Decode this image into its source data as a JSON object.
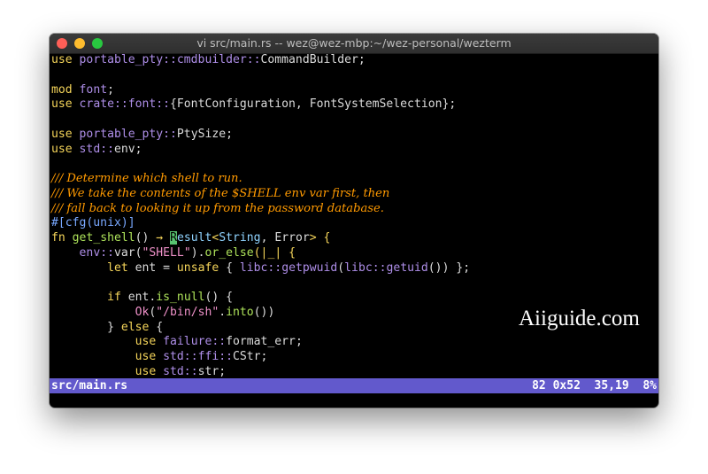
{
  "window": {
    "title": "vi src/main.rs -- wez@wez-mbp:~/wez-personal/wezterm"
  },
  "colors": {
    "background": "#000000",
    "keyword": "#f5d55a",
    "path": "#ae8ee8",
    "string": "#ef91c9",
    "function": "#aee35a",
    "type": "#8fd3ff",
    "comment": "#ff9a00",
    "statusbar": "#6259cc",
    "cursor": "#58c270"
  },
  "code": {
    "l1": {
      "a": "use",
      "b": " ",
      "c": "portable_pty::cmdbuilder::",
      "d": "CommandBuilder;"
    },
    "l3": {
      "a": "mod",
      "b": " ",
      "c": "font",
      "d": ";"
    },
    "l4": {
      "a": "use",
      "b": " ",
      "c": "crate::font::",
      "d": "{FontConfiguration, FontSystemSelection};"
    },
    "l6": {
      "a": "use",
      "b": " ",
      "c": "portable_pty::",
      "d": "PtySize;"
    },
    "l7": {
      "a": "use",
      "b": " ",
      "c": "std::",
      "d": "env;"
    },
    "l9": "/// Determine which shell to run.",
    "l10": "/// We take the contents of the $SHELL env var first, then",
    "l11": "/// fall back to looking it up from the password database.",
    "l12": "#[cfg(unix)]",
    "l13": {
      "a": "fn",
      "b": " ",
      "c": "get_shell",
      "d": "() ",
      "e": "→",
      "f": " ",
      "g": "R",
      "h": "esult",
      "i": "<",
      "j": "String",
      "k": ", Error",
      "l": "> {"
    },
    "l14": {
      "a": "    ",
      "b": "env::",
      "c": "var(",
      "d": "\"SHELL\"",
      "e": ").",
      "f": "or_else",
      "g": "(|_| {"
    },
    "l15": {
      "a": "        ",
      "b": "let",
      "c": " ent = ",
      "d": "unsafe",
      "e": " { ",
      "f": "libc::",
      "g": "getpwuid",
      "h": "(",
      "i": "libc::",
      "j": "getuid",
      "k": "()) };"
    },
    "l17": {
      "a": "        ",
      "b": "if",
      "c": " ent.",
      "d": "is_null",
      "e": "() {"
    },
    "l18": {
      "a": "            ",
      "b": "Ok",
      "c": "(",
      "d": "\"/bin/sh\"",
      "e": ".",
      "f": "into",
      "g": "())"
    },
    "l19": {
      "a": "        } ",
      "b": "else",
      "c": " {"
    },
    "l20": {
      "a": "            ",
      "b": "use",
      "c": " ",
      "d": "failure::",
      "e": "format_err;"
    },
    "l21": {
      "a": "            ",
      "b": "use",
      "c": " ",
      "d": "std::ffi::",
      "e": "CStr;"
    },
    "l22": {
      "a": "            ",
      "b": "use",
      "c": " ",
      "d": "std::",
      "e": "str;"
    }
  },
  "status": {
    "file": "src/main.rs",
    "position": "82 0x52  35,19  8%"
  },
  "watermark": "Aiiguide.com"
}
